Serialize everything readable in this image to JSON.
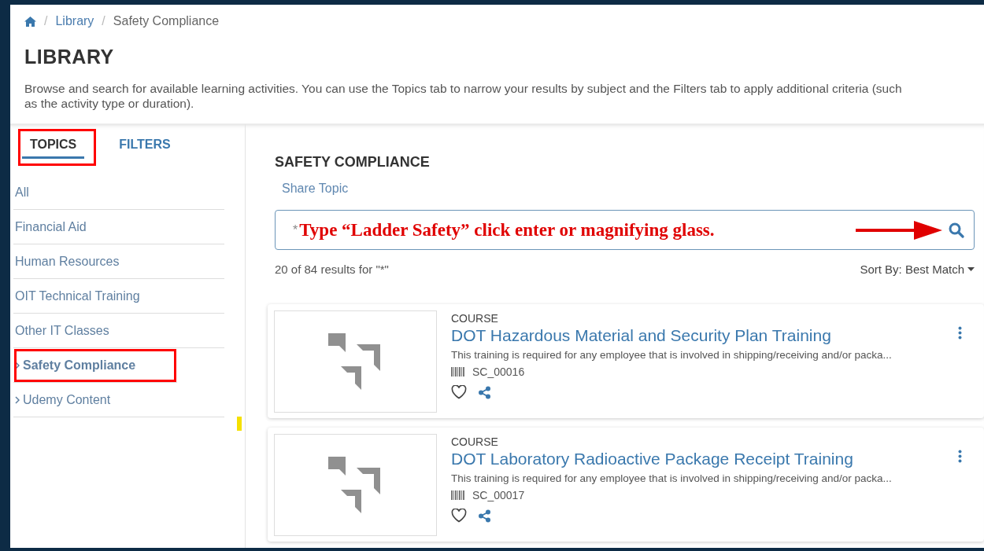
{
  "breadcrumb_separator": "/",
  "breadcrumb": [
    {
      "label": "Library",
      "kind": "link"
    },
    {
      "label": "Safety Compliance",
      "kind": "current"
    }
  ],
  "page_title": "LIBRARY",
  "description_lines": [
    "Browse and search for available learning activities. You can use the Topics tab to narrow your results by subject and the Filters tab to apply additional criteria (such",
    "as the activity type or duration)."
  ],
  "tabs": [
    {
      "label": "TOPICS",
      "selected": true,
      "highlighted": true
    },
    {
      "label": "FILTERS",
      "selected": false,
      "highlighted": false
    }
  ],
  "topics": [
    {
      "label": "All",
      "expandable": false,
      "selected": false,
      "highlighted": false
    },
    {
      "label": "Financial Aid",
      "expandable": false,
      "selected": false,
      "highlighted": false
    },
    {
      "label": "Human Resources",
      "expandable": false,
      "selected": false,
      "highlighted": false
    },
    {
      "label": "OIT Technical Training",
      "expandable": false,
      "selected": false,
      "highlighted": false
    },
    {
      "label": "Other IT Classes",
      "expandable": false,
      "selected": false,
      "highlighted": false
    },
    {
      "label": "Safety Compliance",
      "expandable": true,
      "selected": true,
      "highlighted": true
    },
    {
      "label": "Udemy Content",
      "expandable": true,
      "selected": false,
      "highlighted": false
    }
  ],
  "topic_heading": "SAFETY COMPLIANCE",
  "share_topic": "Share Topic",
  "search": {
    "value": "*",
    "annotation": "Type  “Ladder Safety” click enter or magnifying glass."
  },
  "results_count": "20 of 84 results for \"*\"",
  "sort": {
    "label": "Sort By:",
    "value": "Best Match"
  },
  "results": [
    {
      "type": "COURSE",
      "title": "DOT Hazardous Material and Security Plan Training",
      "description": "This training is required for any employee that is involved in shipping/receiving and/or packa...",
      "code": "SC_00016",
      "favorite": false
    },
    {
      "type": "COURSE",
      "title": "DOT Laboratory Radioactive Package Receipt Training",
      "description": "This training is required for any employee that is involved in shipping/receiving and/or packa...",
      "code": "SC_00017",
      "favorite": false
    }
  ]
}
